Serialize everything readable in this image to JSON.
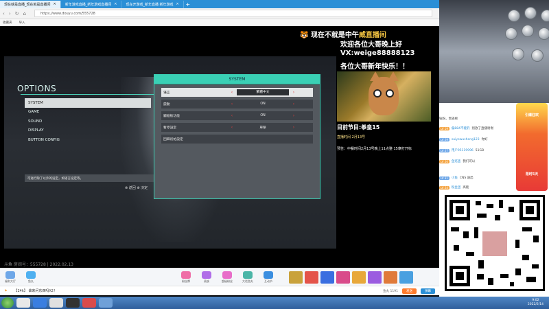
{
  "browser": {
    "tabs": [
      {
        "label": "现在就是直播_现在就是直播间"
      },
      {
        "label": "新年游戏直播_新年游戏直播间"
      },
      {
        "label": "现在开游戏_新年直播 新年游戏"
      }
    ],
    "url": "https://www.douyu.com/555728",
    "bookmarks": [
      "收藏夹",
      "导入"
    ]
  },
  "stream_overlay": {
    "headline": "现在不就是中午",
    "headline_tag": "威直播间",
    "lines": [
      "欢迎各位大哥晚上好",
      "VX:weige88888123",
      "各位大哥新年快乐！！"
    ],
    "current_program": "目前节目:拳皇15",
    "schedule_1": "直播时间 2月13号",
    "schedule_2": "预告：中餐时间2月13号晚上11点整 15章打开标"
  },
  "game": {
    "options_title": "OPTIONS",
    "options_items": [
      "SYSTEM",
      "GAME",
      "SOUND",
      "DISPLAY",
      "BUTTON CONFIG"
    ],
    "options_help": "可进行除了以外的设定，如语言设定等。",
    "options_footer": "⊗ 返回  ⊕ 决定",
    "system_title": "SYSTEM",
    "system_rows": [
      {
        "label": "语言",
        "value": "繁體中文"
      },
      {
        "label": "震動",
        "value": "ON"
      },
      {
        "label": "觸碰板功能",
        "value": "ON"
      },
      {
        "label": "暫停設定",
        "value": "單擊"
      },
      {
        "label": "回歸初始設定",
        "value": ""
      }
    ]
  },
  "room_line": "斗鱼 房间号：555728 | 2022.02.13",
  "giftbar": {
    "left_buttons": [
      "福利大厅",
      "鱼丸"
    ],
    "mid_buttons": [
      "粉丝牌",
      "贵族",
      "超级粉丝",
      "大话鱼丸",
      "互动节"
    ],
    "right_label": "鱼丸 1191"
  },
  "chatbar": {
    "message": "【24k】 谁来问东西吗X2！",
    "send_label": "发送",
    "sub_label": "弹幕"
  },
  "right_panel": {
    "fans_title": "钻粉，贵族榜",
    "fans": [
      {
        "level": "LV 19",
        "name": "偏884不能钓",
        "text": "别放了直播谢谢"
      },
      {
        "level": "LV 29",
        "name": "suiyewusheng123",
        "text": "你好"
      },
      {
        "level": "LV 27",
        "name": "用户95119996",
        "text": "51GB"
      },
      {
        "level": "LV 20",
        "name": "鱼巡查",
        "text": "我们可以"
      },
      {
        "level": "LV 31",
        "name": "小鱼",
        "text": "CNS 送出"
      },
      {
        "level": "LV 24",
        "name": "粉丝团",
        "text": "高能"
      }
    ],
    "promo_title": "引爆狂欢",
    "promo_sub": "限时5天"
  },
  "taskbar": {
    "time": "9:02",
    "date": "2022/2/14"
  }
}
